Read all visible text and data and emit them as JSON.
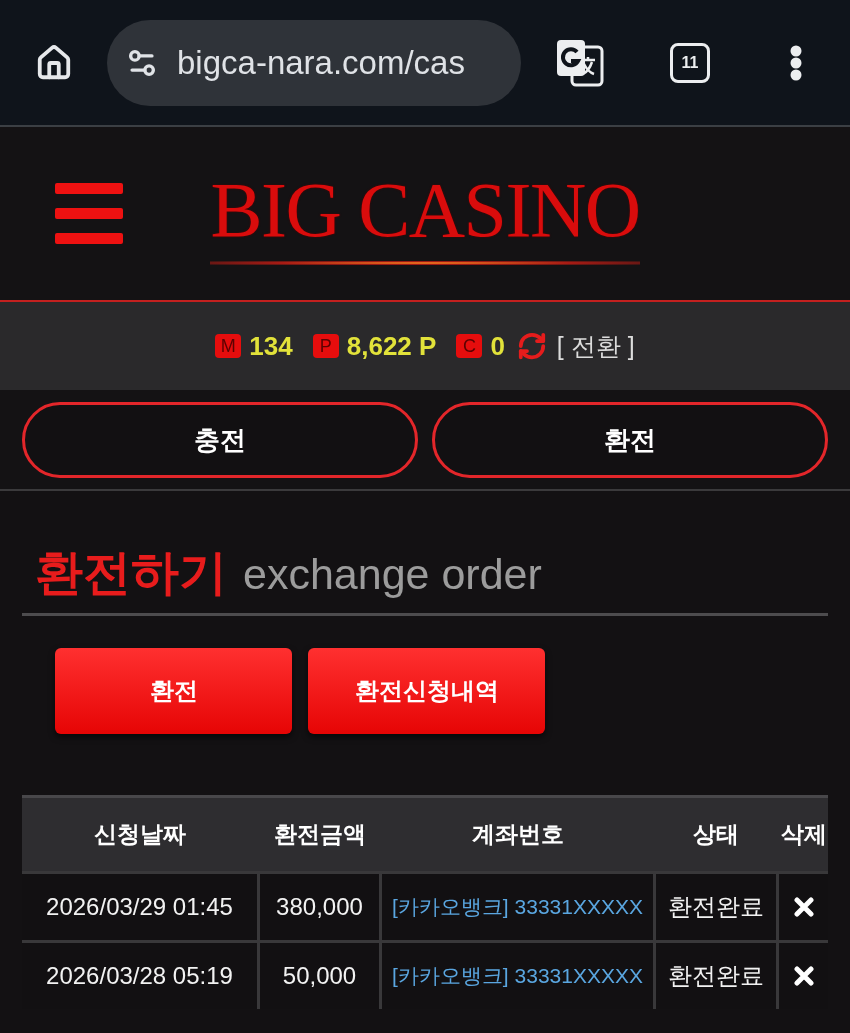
{
  "browser": {
    "url": "bigca-nara.com/cas",
    "tab_count": "11"
  },
  "header": {
    "logo": "BIG CASINO"
  },
  "balances": [
    {
      "badge": "M",
      "value": "134"
    },
    {
      "badge": "P",
      "value": "8,622 P"
    },
    {
      "badge": "C",
      "value": "0"
    }
  ],
  "convert_link": "[ 전환 ]",
  "nav_buttons": [
    "충전",
    "환전"
  ],
  "title": {
    "main": "환전하기",
    "sub": "exchange order"
  },
  "actions": [
    "환전",
    "환전신청내역"
  ],
  "table": {
    "columns": [
      "신청날짜",
      "환전금액",
      "계좌번호",
      "상태",
      "삭제"
    ],
    "rows": [
      {
        "date": "2026/03/29 01:45",
        "amount": "380,000",
        "account": "[카카오뱅크] 33331XXXXX",
        "status": "환전완료"
      },
      {
        "date": "2026/03/28 05:19",
        "amount": "50,000",
        "account": "[카카오뱅크] 33331XXXXX",
        "status": "환전완료"
      }
    ]
  }
}
